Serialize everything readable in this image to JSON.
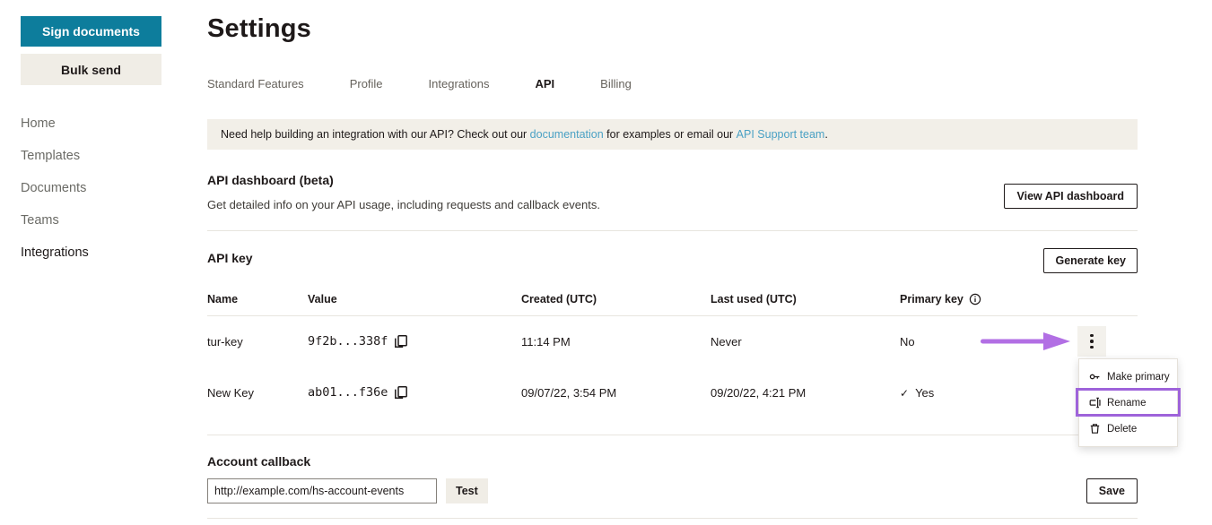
{
  "sidebar": {
    "sign_documents_label": "Sign documents",
    "bulk_send_label": "Bulk send",
    "items": [
      {
        "label": "Home"
      },
      {
        "label": "Templates"
      },
      {
        "label": "Documents"
      },
      {
        "label": "Teams"
      },
      {
        "label": "Integrations",
        "active": true
      }
    ]
  },
  "header": {
    "title": "Settings"
  },
  "tabs": [
    {
      "label": "Standard Features"
    },
    {
      "label": "Profile"
    },
    {
      "label": "Integrations"
    },
    {
      "label": "API",
      "active": true
    },
    {
      "label": "Billing"
    }
  ],
  "banner": {
    "text_before": "Need help building an integration with our API? Check out our ",
    "link_documentation": "documentation",
    "text_middle": " for examples or email our ",
    "link_support": "API Support team",
    "text_after": "."
  },
  "api_dashboard": {
    "heading": "API dashboard (beta)",
    "description": "Get detailed info on your API usage, including requests and callback events.",
    "button_label": "View API dashboard"
  },
  "api_key": {
    "heading": "API key",
    "generate_button_label": "Generate key",
    "columns": [
      "Name",
      "Value",
      "Created (UTC)",
      "Last used (UTC)",
      "Primary key"
    ],
    "rows": [
      {
        "name": "tur-key",
        "value": "9f2b...338f",
        "created": "11:14 PM",
        "last_used": "Never",
        "primary": "No",
        "check": ""
      },
      {
        "name": "New Key",
        "value": "ab01...f36e",
        "created": "09/07/22, 3:54 PM",
        "last_used": "09/20/22, 4:21 PM",
        "primary": "Yes",
        "check": "✓"
      }
    ]
  },
  "row_menu": {
    "items": [
      {
        "label": "Make primary",
        "icon": "key-icon"
      },
      {
        "label": "Rename",
        "icon": "rename-icon",
        "highlighted": true
      },
      {
        "label": "Delete",
        "icon": "trash-icon"
      }
    ]
  },
  "account_callback": {
    "heading": "Account callback",
    "url_value": "http://example.com/hs-account-events",
    "test_button_label": "Test",
    "save_button_label": "Save"
  },
  "colors": {
    "accent_teal": "#0d7d9c",
    "annotation_purple": "#b26fe4",
    "highlight_purple": "#9e63da",
    "link_blue": "#4aa1c4",
    "banner_beige": "#f2efe8"
  }
}
